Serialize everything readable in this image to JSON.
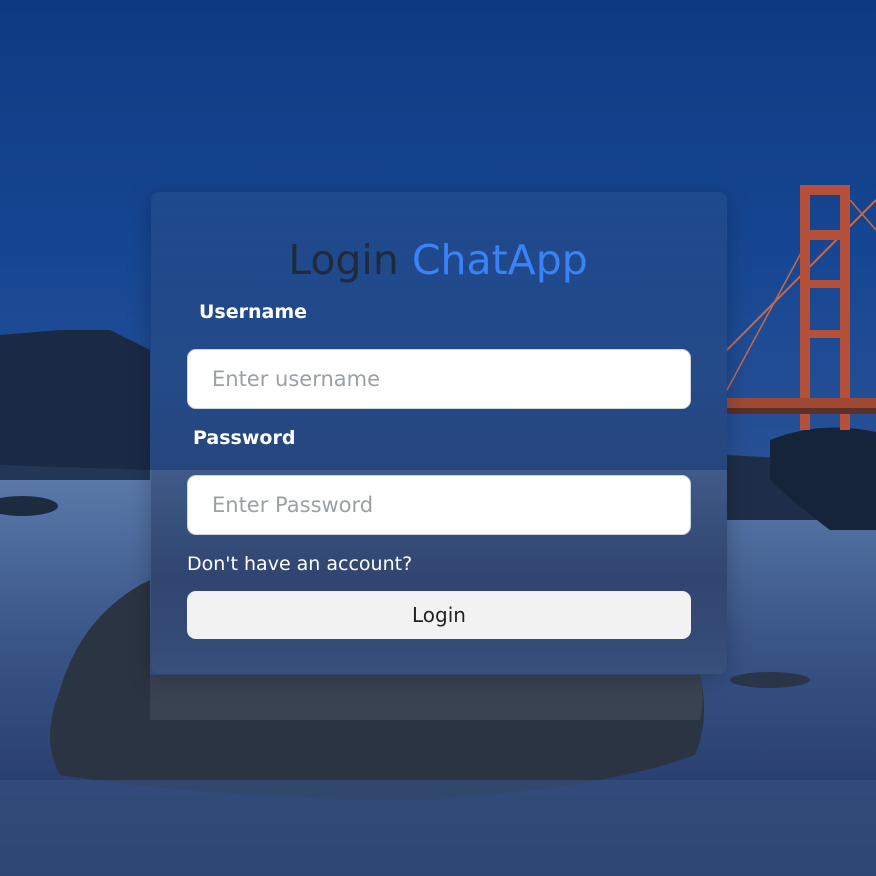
{
  "login": {
    "title_prefix": "Login",
    "title_brand": "ChatApp",
    "username_label": "Username",
    "username_placeholder": "Enter username",
    "username_value": "",
    "password_label": "Password",
    "password_placeholder": "Enter Password",
    "password_value": "",
    "signup_link": "Don't have an account?",
    "submit_label": "Login"
  },
  "colors": {
    "brand_accent": "#3b82f6",
    "title_dark": "#1f2a3c",
    "button_bg": "#f2f2f2",
    "sky": "#0d3a82"
  }
}
